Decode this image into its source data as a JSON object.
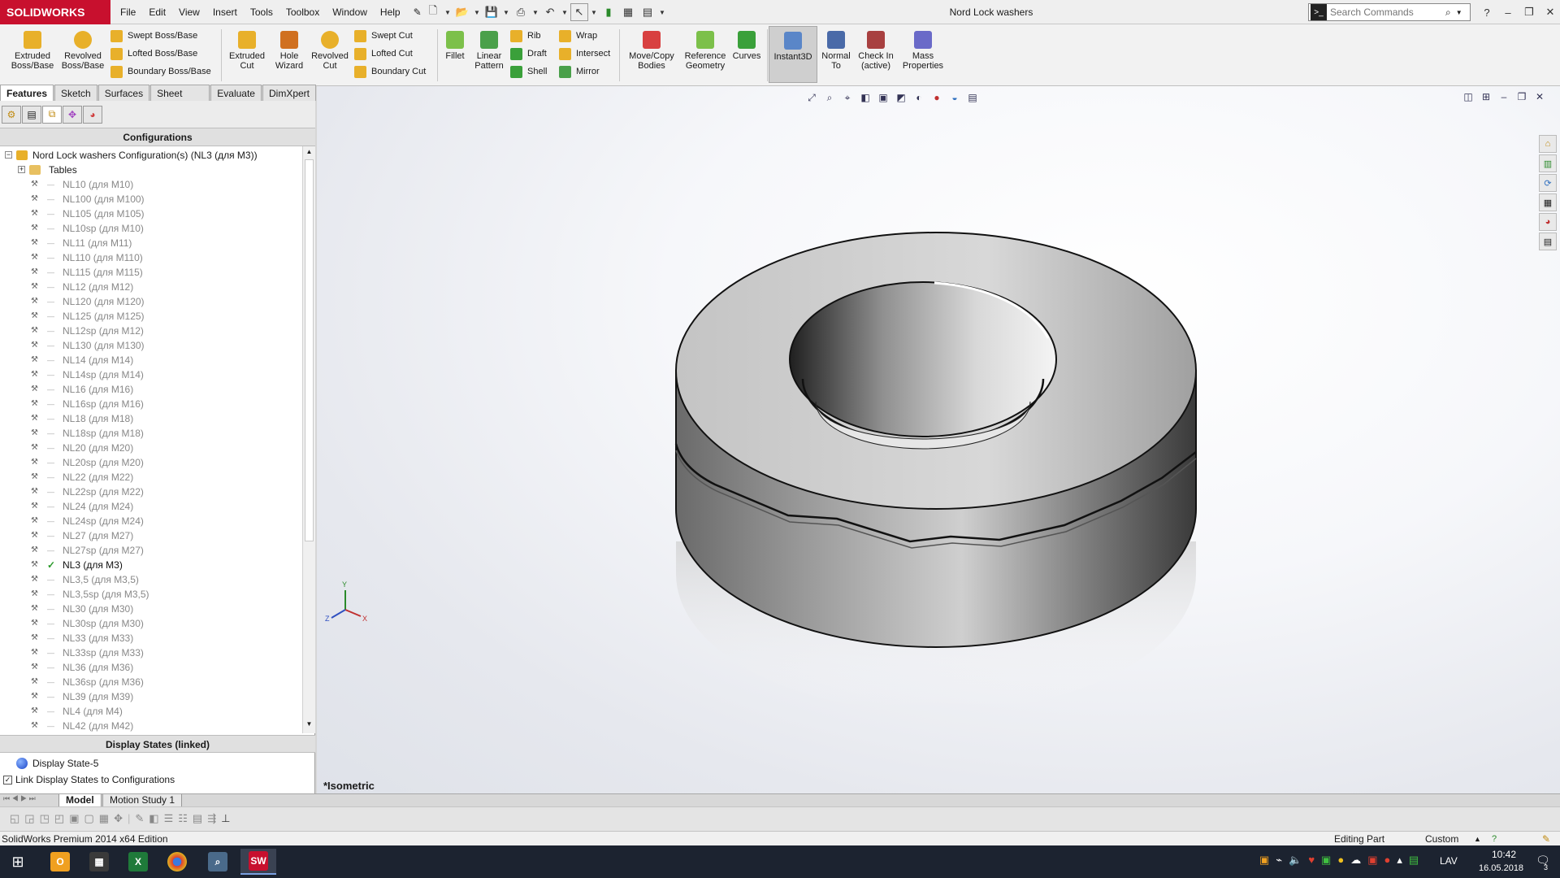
{
  "app": {
    "logo": "SOLIDWORKS",
    "document_title": "Nord Lock washers"
  },
  "menu": [
    "File",
    "Edit",
    "View",
    "Insert",
    "Tools",
    "Toolbox",
    "Window",
    "Help"
  ],
  "search": {
    "placeholder": "Search Commands"
  },
  "ribbon": {
    "extruded_boss": "Extruded\nBoss/Base",
    "revolved_boss": "Revolved\nBoss/Base",
    "swept_boss": "Swept Boss/Base",
    "lofted_boss": "Lofted Boss/Base",
    "boundary_boss": "Boundary Boss/Base",
    "extruded_cut": "Extruded\nCut",
    "hole_wizard": "Hole\nWizard",
    "revolved_cut": "Revolved\nCut",
    "swept_cut": "Swept Cut",
    "lofted_cut": "Lofted Cut",
    "boundary_cut": "Boundary Cut",
    "fillet": "Fillet",
    "linear_pattern": "Linear\nPattern",
    "rib": "Rib",
    "draft": "Draft",
    "shell": "Shell",
    "wrap": "Wrap",
    "intersect": "Intersect",
    "mirror": "Mirror",
    "move_copy": "Move/Copy\nBodies",
    "ref_geometry": "Reference\nGeometry",
    "curves": "Curves",
    "instant3d": "Instant3D",
    "normal_to": "Normal\nTo",
    "check_in": "Check In\n(active)",
    "mass_props": "Mass\nProperties"
  },
  "command_tabs": [
    "Features",
    "Sketch",
    "Surfaces",
    "Sheet Metal",
    "Evaluate",
    "DimXpert"
  ],
  "config_panel": {
    "header": "Configurations",
    "root": "Nord Lock washers Configuration(s)  (NL3 (для M3))",
    "tables": "Tables",
    "items": [
      "NL10 (для M10)",
      "NL100 (для M100)",
      "NL105 (для M105)",
      "NL10sp (для M10)",
      "NL11 (для M11)",
      "NL110 (для M110)",
      "NL115 (для M115)",
      "NL12 (для M12)",
      "NL120 (для M120)",
      "NL125 (для M125)",
      "NL12sp (для M12)",
      "NL130 (для M130)",
      "NL14 (для M14)",
      "NL14sp (для M14)",
      "NL16 (для M16)",
      "NL16sp (для M16)",
      "NL18 (для M18)",
      "NL18sp (для M18)",
      "NL20 (для M20)",
      "NL20sp (для M20)",
      "NL22 (для M22)",
      "NL22sp (для M22)",
      "NL24 (для M24)",
      "NL24sp (для M24)",
      "NL27 (для M27)",
      "NL27sp (для M27)",
      "NL3 (для M3)",
      "NL3,5 (для M3,5)",
      "NL3,5sp (для M3,5)",
      "NL30 (для M30)",
      "NL30sp (для M30)",
      "NL33 (для M33)",
      "NL33sp (для M33)",
      "NL36 (для M36)",
      "NL36sp (для M36)",
      "NL39 (для M39)",
      "NL4 (для M4)",
      "NL42 (для M42)"
    ],
    "active_index": 26
  },
  "display_states": {
    "header": "Display States (linked)",
    "item": "Display State-5",
    "link_label": "Link Display States to Configurations"
  },
  "viewport": {
    "view_label": "*Isometric",
    "triad": {
      "x": "X",
      "y": "Y",
      "z": "Z"
    }
  },
  "bottom_tabs": [
    "Model",
    "Motion Study 1"
  ],
  "status": {
    "edition": "SolidWorks Premium 2014 x64 Edition",
    "mode": "Editing Part",
    "units": "Custom"
  },
  "taskbar": {
    "lang": "LAV",
    "time": "10:42",
    "date": "16.05.2018",
    "notifications": "3"
  },
  "colors": {
    "accent": "#c8102e",
    "taskbar": "#1c2330"
  }
}
